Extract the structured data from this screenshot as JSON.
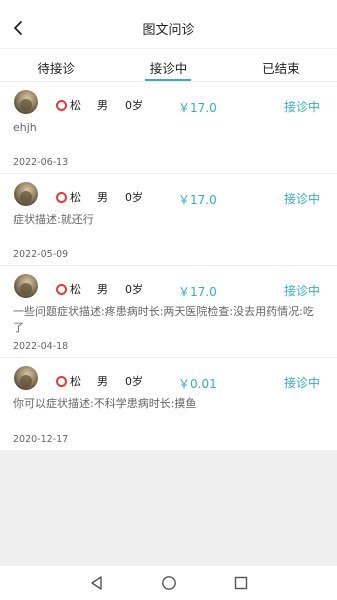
{
  "header": {
    "title": "图文问诊"
  },
  "tabs": [
    {
      "label": "待接诊"
    },
    {
      "label": "接诊中"
    },
    {
      "label": "已结束"
    }
  ],
  "patients": [
    {
      "name": "松",
      "gender": "男",
      "age": "0岁",
      "price": "￥17.0",
      "status": "接诊中",
      "description": "ehjh",
      "date": "2022-06-13"
    },
    {
      "name": "松",
      "gender": "男",
      "age": "0岁",
      "price": "￥17.0",
      "status": "接诊中",
      "description": "症状描述:就还行",
      "date": "2022-05-09"
    },
    {
      "name": "松",
      "gender": "男",
      "age": "0岁",
      "price": "￥17.0",
      "status": "接诊中",
      "description": "一些问题症状描述:疼患病时长:两天医院检查:没去用药情况:吃了",
      "date": "2022-04-18"
    },
    {
      "name": "松",
      "gender": "男",
      "age": "0岁",
      "price": "￥0.01",
      "status": "接诊中",
      "description": "你可以症状描述:不科学患病时长:摸鱼",
      "date": "2020-12-17"
    }
  ],
  "colors": {
    "accent": "#39aac8",
    "name_ring": "#e33b3b",
    "background_gray": "#efefef"
  },
  "icons": {
    "back": "chevron-left-icon",
    "nav_back": "triangle-back-icon",
    "nav_home": "circle-home-icon",
    "nav_recent": "square-recent-icon"
  }
}
